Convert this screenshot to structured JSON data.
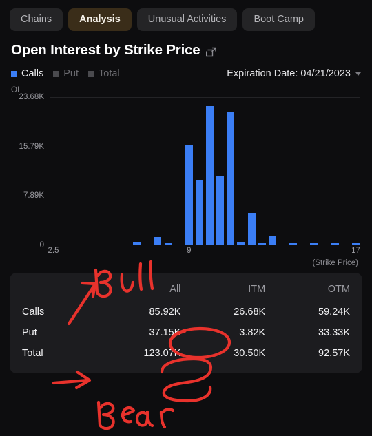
{
  "tabs": [
    {
      "label": "Chains",
      "active": false
    },
    {
      "label": "Analysis",
      "active": true
    },
    {
      "label": "Unusual Activities",
      "active": false
    },
    {
      "label": "Boot Camp",
      "active": false
    }
  ],
  "header": {
    "title": "Open Interest by Strike Price",
    "share_icon": "share-external-icon"
  },
  "legend": [
    {
      "label": "Calls",
      "active": true,
      "color": "#3b7ef5"
    },
    {
      "label": "Put",
      "active": false,
      "color": "#4a4a4e"
    },
    {
      "label": "Total",
      "active": false,
      "color": "#4a4a4e"
    }
  ],
  "expiration": {
    "label": "Expiration Date: 04/21/2023",
    "caret_icon": "chevron-down-icon"
  },
  "chart_data": {
    "type": "bar",
    "title": "Open Interest by Strike Price",
    "xlabel": "(Strike Price)",
    "ylabel": "OI",
    "ylim": [
      0,
      23680
    ],
    "ytick_labels": [
      "23.68K",
      "15.79K",
      "7.89K",
      "0"
    ],
    "ytick_values": [
      23680,
      15790,
      7890,
      0
    ],
    "xtick_labels": [
      "2.5",
      "9",
      "17"
    ],
    "xtick_values": [
      2.5,
      9,
      17
    ],
    "grid": true,
    "legend_position": "top-left",
    "series": [
      {
        "name": "Calls",
        "color": "#3b7ef5",
        "categories": [
          2.5,
          3,
          3.5,
          4,
          4.5,
          5,
          5.5,
          6,
          6.5,
          7,
          7.5,
          8,
          8.5,
          9,
          9.5,
          10,
          10.5,
          11,
          11.5,
          12,
          12.5,
          13,
          14,
          15,
          16,
          17
        ],
        "values": [
          0,
          0,
          0,
          0,
          0,
          0,
          0,
          0,
          560,
          0,
          1350,
          250,
          0,
          16100,
          10300,
          22300,
          11000,
          21300,
          450,
          5200,
          230,
          1500,
          90,
          230,
          230,
          180
        ]
      }
    ]
  },
  "summary": {
    "columns": [
      "All",
      "ITM",
      "OTM"
    ],
    "rows": [
      {
        "label": "Calls",
        "values": [
          "85.92K",
          "26.68K",
          "59.24K"
        ]
      },
      {
        "label": "Put",
        "values": [
          "37.15K",
          "3.82K",
          "33.33K"
        ]
      },
      {
        "label": "Total",
        "values": [
          "123.07K",
          "30.50K",
          "92.57K"
        ]
      }
    ]
  },
  "annotations": {
    "color": "#e8322c",
    "marks": [
      {
        "type": "handwriting",
        "text": "Bull"
      },
      {
        "type": "handwriting",
        "text": "Bear"
      },
      {
        "type": "arrow",
        "name": "bull-arrow"
      },
      {
        "type": "arrow",
        "name": "bear-arrow"
      },
      {
        "type": "circle",
        "name": "calls-all-circle"
      },
      {
        "type": "circle",
        "name": "put-all-circle"
      }
    ]
  }
}
